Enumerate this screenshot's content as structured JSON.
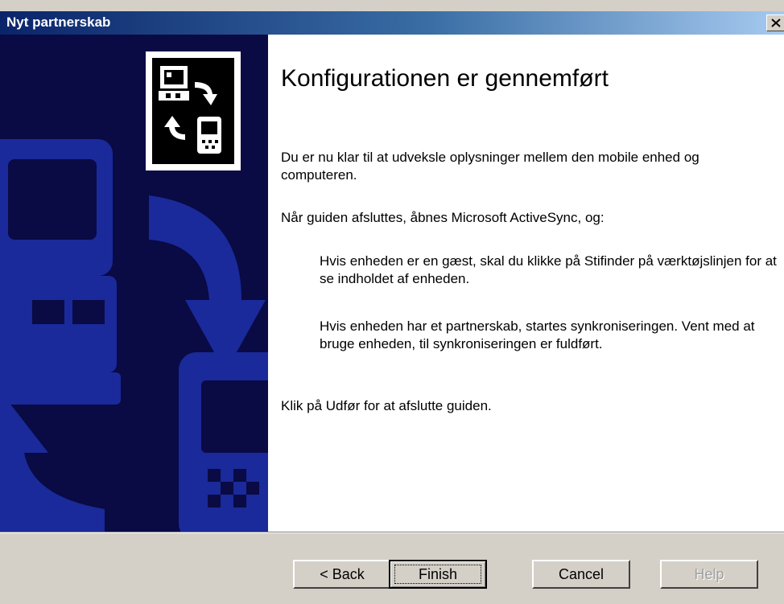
{
  "window": {
    "title": "Nyt partnerskab"
  },
  "content": {
    "heading": "Konfigurationen er gennemført",
    "para_ready": "Du er nu klar til at udveksle oplysninger mellem den mobile enhed og computeren.",
    "para_when": "Når guiden afsluttes, åbnes Microsoft ActiveSync, og:",
    "para_guest": "Hvis enheden er en gæst, skal du klikke på Stifinder på værktøjslinjen for at se indholdet af enheden.",
    "para_partner": "Hvis enheden har et partnerskab, startes synkroniseringen. Vent med at bruge enheden, til synkroniseringen er fuldført.",
    "para_finish": "Klik på Udfør for at afslutte guiden."
  },
  "buttons": {
    "back": "< Back",
    "finish": "Finish",
    "cancel": "Cancel",
    "help": "Help"
  },
  "colors": {
    "sidepanel_bg": "#0a0a44",
    "sidepanel_art": "#1a2a9a",
    "titlebar_start": "#0a246a",
    "titlebar_end": "#a6caf0"
  },
  "icons": {
    "wizard": "sync-device-icon",
    "close": "close-icon"
  }
}
